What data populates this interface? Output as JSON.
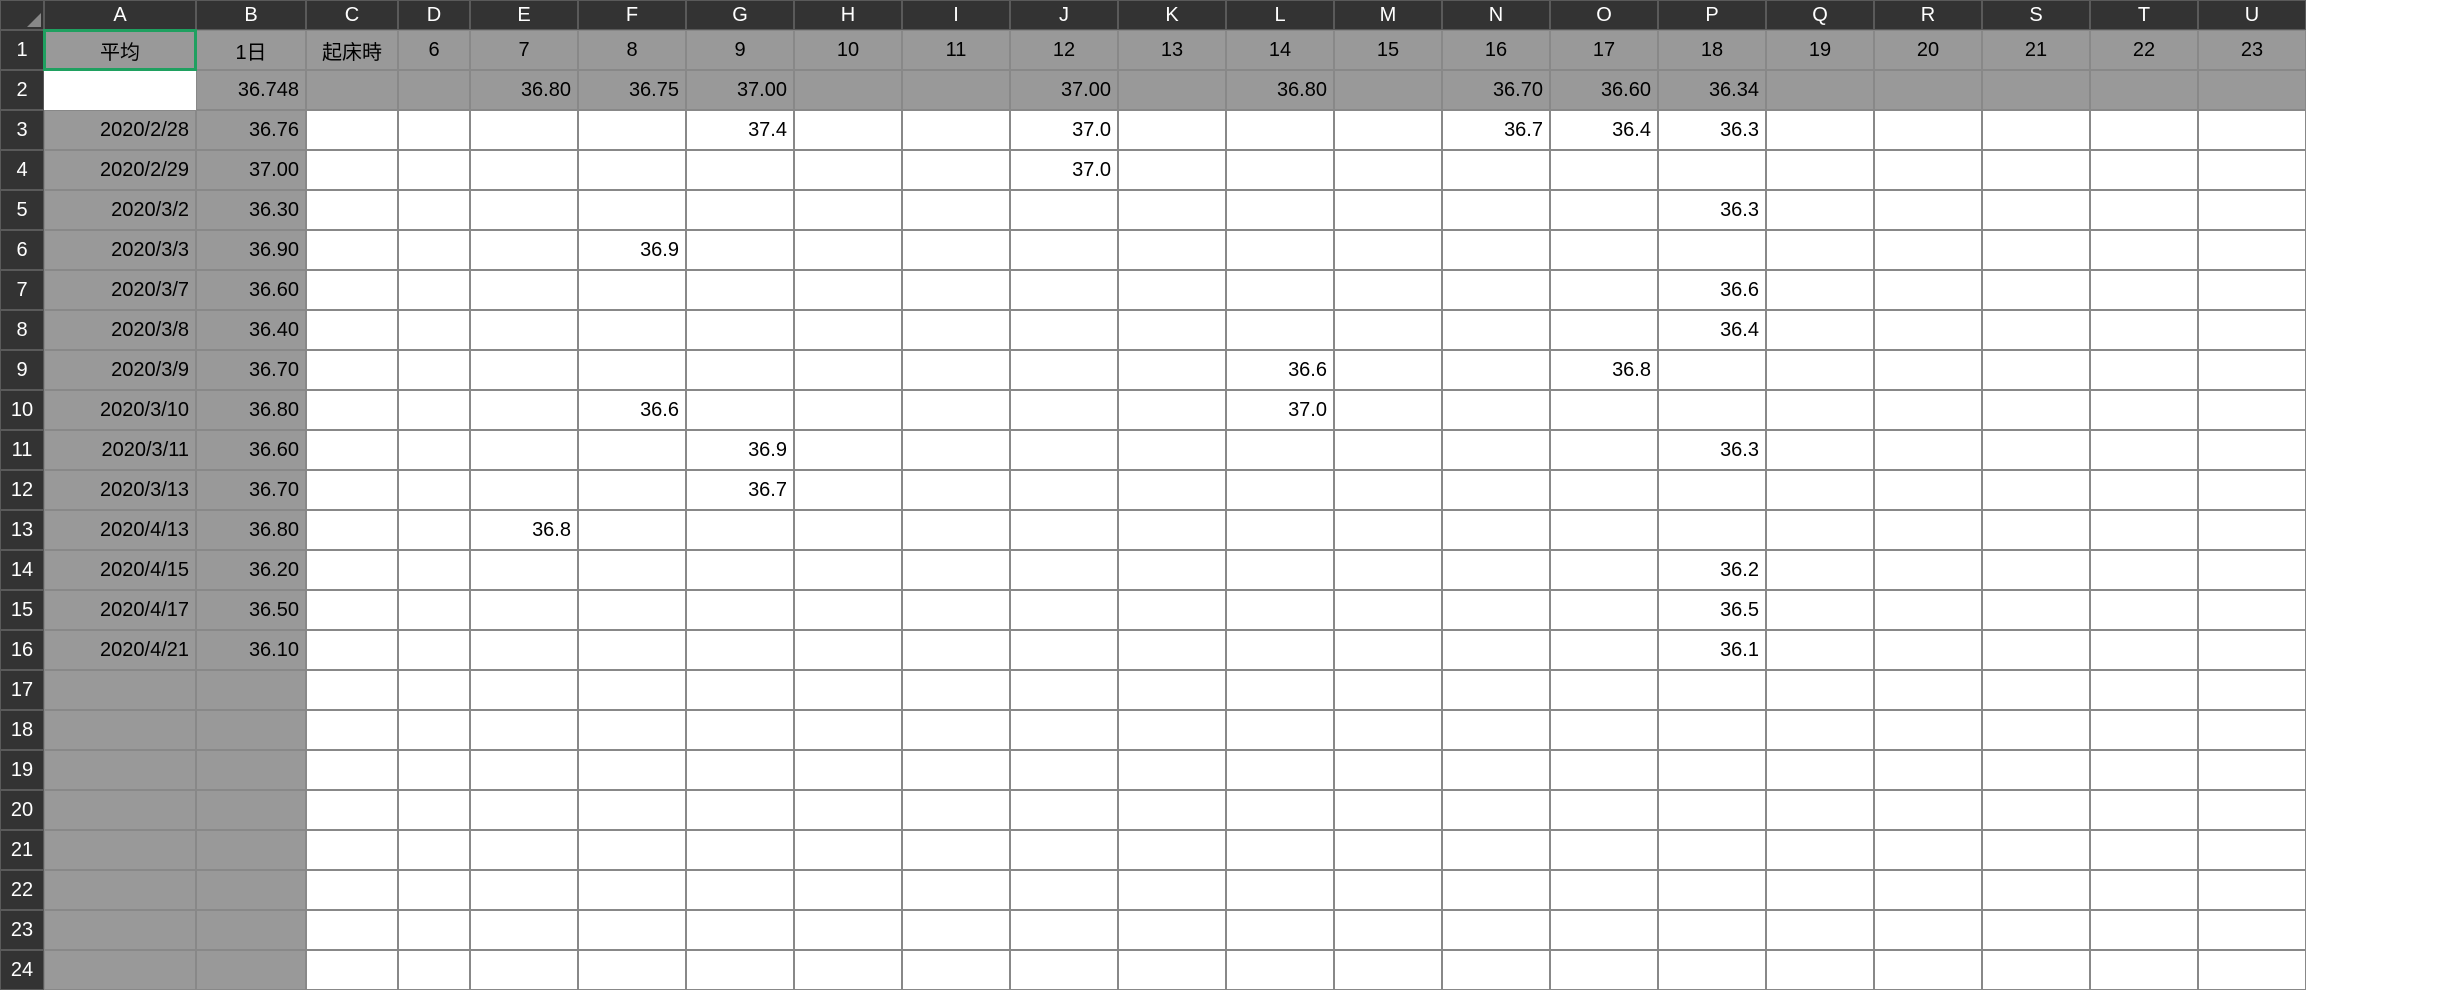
{
  "columns": [
    "A",
    "B",
    "C",
    "D",
    "E",
    "F",
    "G",
    "H",
    "I",
    "J",
    "K",
    "L",
    "M",
    "N",
    "O",
    "P",
    "Q",
    "R",
    "S",
    "T",
    "U"
  ],
  "colWidths": {
    "rowhdr": 44,
    "A": 152,
    "B": 110,
    "C": 92,
    "D": 72,
    "E": 108,
    "F": 108,
    "G": 108,
    "H": 108,
    "I": 108,
    "J": 108,
    "K": 108,
    "L": 108,
    "M": 108,
    "N": 108,
    "O": 108,
    "P": 108,
    "Q": 108,
    "R": 108,
    "S": 108,
    "T": 108,
    "U": 108
  },
  "rowCount": 24,
  "mergedA": {
    "text": "平均",
    "rows": [
      1,
      2
    ]
  },
  "selectedCell": "A1",
  "header1": {
    "B": "1日",
    "C": "起床時",
    "D": "6",
    "E": "7",
    "F": "8",
    "G": "9",
    "H": "10",
    "I": "11",
    "J": "12",
    "K": "13",
    "L": "14",
    "M": "15",
    "N": "16",
    "O": "17",
    "P": "18",
    "Q": "19",
    "R": "20",
    "S": "21",
    "T": "22",
    "U": "23"
  },
  "header2": {
    "B": "36.748",
    "E": "36.80",
    "F": "36.75",
    "G": "37.00",
    "J": "37.00",
    "L": "36.80",
    "N": "36.70",
    "O": "36.60",
    "P": "36.34"
  },
  "dataRows": {
    "3": {
      "A": "2020/2/28",
      "B": "36.76",
      "G": "37.4",
      "J": "37.0",
      "N": "36.7",
      "O": "36.4",
      "P": "36.3"
    },
    "4": {
      "A": "2020/2/29",
      "B": "37.00",
      "J": "37.0"
    },
    "5": {
      "A": "2020/3/2",
      "B": "36.30",
      "P": "36.3"
    },
    "6": {
      "A": "2020/3/3",
      "B": "36.90",
      "F": "36.9"
    },
    "7": {
      "A": "2020/3/7",
      "B": "36.60",
      "P": "36.6"
    },
    "8": {
      "A": "2020/3/8",
      "B": "36.40",
      "P": "36.4"
    },
    "9": {
      "A": "2020/3/9",
      "B": "36.70",
      "L": "36.6",
      "O": "36.8"
    },
    "10": {
      "A": "2020/3/10",
      "B": "36.80",
      "F": "36.6",
      "L": "37.0"
    },
    "11": {
      "A": "2020/3/11",
      "B": "36.60",
      "G": "36.9",
      "P": "36.3"
    },
    "12": {
      "A": "2020/3/13",
      "B": "36.70",
      "G": "36.7"
    },
    "13": {
      "A": "2020/4/13",
      "B": "36.80",
      "E": "36.8"
    },
    "14": {
      "A": "2020/4/15",
      "B": "36.20",
      "P": "36.2"
    },
    "15": {
      "A": "2020/4/17",
      "B": "36.50",
      "P": "36.5"
    },
    "16": {
      "A": "2020/4/21",
      "B": "36.10",
      "P": "36.1"
    }
  },
  "chart_data": {
    "type": "table",
    "title": "平均",
    "columns": [
      "1日",
      "起床時",
      "6",
      "7",
      "8",
      "9",
      "10",
      "11",
      "12",
      "13",
      "14",
      "15",
      "16",
      "17",
      "18",
      "19",
      "20",
      "21",
      "22",
      "23"
    ],
    "summary_row": {
      "1日": 36.748,
      "7": 36.8,
      "8": 36.75,
      "9": 37.0,
      "12": 37.0,
      "14": 36.8,
      "16": 36.7,
      "17": 36.6,
      "18": 36.34
    },
    "rows": [
      {
        "date": "2020/2/28",
        "1日": 36.76,
        "9": 37.4,
        "12": 37.0,
        "16": 36.7,
        "17": 36.4,
        "18": 36.3
      },
      {
        "date": "2020/2/29",
        "1日": 37.0,
        "12": 37.0
      },
      {
        "date": "2020/3/2",
        "1日": 36.3,
        "18": 36.3
      },
      {
        "date": "2020/3/3",
        "1日": 36.9,
        "8": 36.9
      },
      {
        "date": "2020/3/7",
        "1日": 36.6,
        "18": 36.6
      },
      {
        "date": "2020/3/8",
        "1日": 36.4,
        "18": 36.4
      },
      {
        "date": "2020/3/9",
        "1日": 36.7,
        "14": 36.6,
        "17": 36.8
      },
      {
        "date": "2020/3/10",
        "1日": 36.8,
        "8": 36.6,
        "14": 37.0
      },
      {
        "date": "2020/3/11",
        "1日": 36.6,
        "9": 36.9,
        "18": 36.3
      },
      {
        "date": "2020/3/13",
        "1日": 36.7,
        "9": 36.7
      },
      {
        "date": "2020/4/13",
        "1日": 36.8,
        "7": 36.8
      },
      {
        "date": "2020/4/15",
        "1日": 36.2,
        "18": 36.2
      },
      {
        "date": "2020/4/17",
        "1日": 36.5,
        "18": 36.5
      },
      {
        "date": "2020/4/21",
        "1日": 36.1,
        "18": 36.1
      }
    ]
  }
}
